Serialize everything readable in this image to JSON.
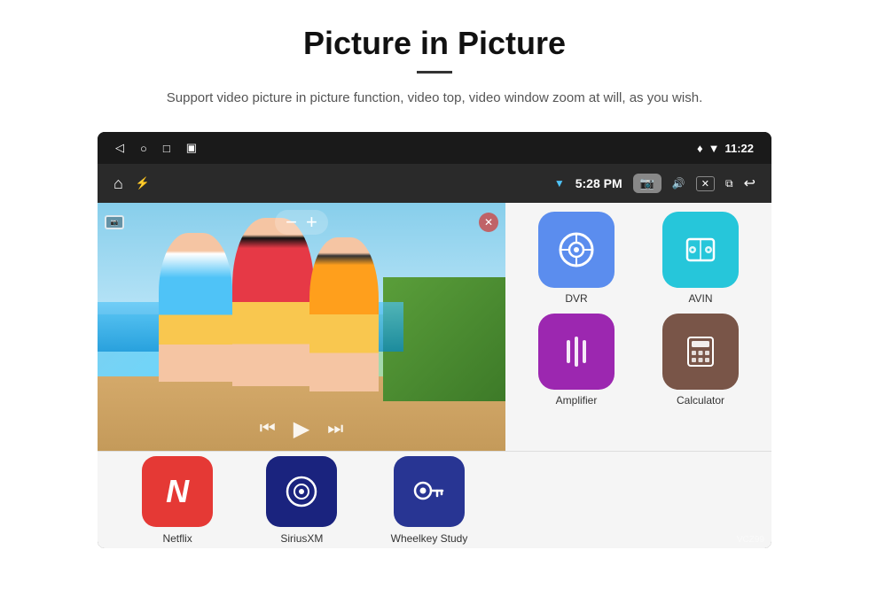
{
  "header": {
    "title": "Picture in Picture",
    "divider": true,
    "subtitle": "Support video picture in picture function, video top, video window zoom at will, as you wish."
  },
  "statusBar": {
    "back_icon": "◁",
    "home_icon": "○",
    "recents_icon": "□",
    "screenshot_icon": "▣",
    "location_icon": "♦",
    "wifi_icon": "▼",
    "time": "11:22"
  },
  "appBar": {
    "home_icon": "⌂",
    "usb_icon": "⚡",
    "wifi_label": "WiFi",
    "time": "5:28 PM",
    "camera_label": "📷",
    "volume_icon": "🔊",
    "close_icon": "✕",
    "pip_icon": "⧉",
    "back_icon": "↩"
  },
  "pipControls": {
    "cam_icon": "📷",
    "minus_label": "−",
    "plus_label": "+",
    "close_label": "✕"
  },
  "playback": {
    "prev_label": "⏮",
    "play_label": "▶",
    "next_label": "⏭"
  },
  "topApps": [
    {
      "label": "Netflix",
      "color": "green"
    },
    {
      "label": "SiriusXM",
      "color": "pink"
    },
    {
      "label": "Wheelkey Study",
      "color": "purple"
    }
  ],
  "rightApps": [
    {
      "label": "DVR",
      "color": "blue",
      "icon": "◎"
    },
    {
      "label": "AVIN",
      "color": "cyan",
      "icon": "🔌"
    }
  ],
  "rightAppsBottom": [
    {
      "label": "Amplifier",
      "color": "purple",
      "icon": "🎚"
    },
    {
      "label": "Calculator",
      "color": "brown",
      "icon": "🖩"
    }
  ],
  "bottomApps": [
    {
      "label": "Netflix",
      "color": "red",
      "icon": "N"
    },
    {
      "label": "SiriusXM",
      "color": "navy",
      "icon": "◉"
    },
    {
      "label": "Wheelkey Study",
      "color": "indigo",
      "icon": "🔑"
    }
  ],
  "watermark": "VCZ99"
}
